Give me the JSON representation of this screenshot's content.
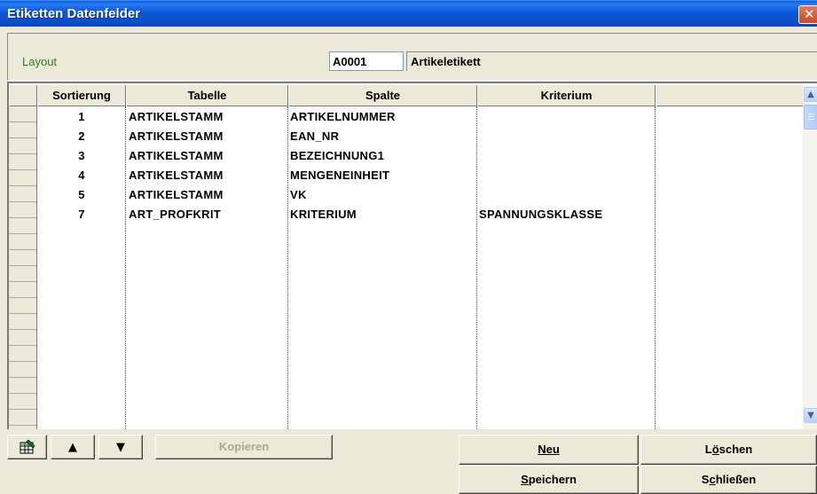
{
  "window": {
    "title": "Etiketten Datenfelder",
    "close_glyph": "✕"
  },
  "layout": {
    "label": "Layout",
    "code": "A0001",
    "name": "Artikeletikett"
  },
  "grid": {
    "columns": [
      "Sortierung",
      "Tabelle",
      "Spalte",
      "Kriterium",
      ""
    ],
    "rows": [
      {
        "sortierung": "1",
        "tabelle": "ARTIKELSTAMM",
        "spalte": "ARTIKELNUMMER",
        "kriterium": ""
      },
      {
        "sortierung": "2",
        "tabelle": "ARTIKELSTAMM",
        "spalte": "EAN_NR",
        "kriterium": ""
      },
      {
        "sortierung": "3",
        "tabelle": "ARTIKELSTAMM",
        "spalte": "BEZEICHNUNG1",
        "kriterium": ""
      },
      {
        "sortierung": "4",
        "tabelle": "ARTIKELSTAMM",
        "spalte": "MENGENEINHEIT",
        "kriterium": ""
      },
      {
        "sortierung": "5",
        "tabelle": "ARTIKELSTAMM",
        "spalte": "VK",
        "kriterium": ""
      },
      {
        "sortierung": "7",
        "tabelle": "ART_PROFKRIT",
        "spalte": "KRITERIUM",
        "kriterium": "SPANNUNGSKLASSE"
      }
    ]
  },
  "toolbar": {
    "grid_icon": "grid-edit-icon",
    "up_glyph": "▲",
    "down_glyph": "▼",
    "copy_label": "Kopieren",
    "new_label": "Neu",
    "delete_label_pre": "L",
    "delete_label_ul": "ö",
    "delete_label_post": "schen",
    "save_label_ul": "S",
    "save_label_post": "peichern",
    "close_label_pre": "S",
    "close_label_ul": "c",
    "close_label_post": "hließen"
  },
  "scroll": {
    "up_glyph": "▲",
    "down_glyph": "▼"
  },
  "colors": {
    "titlebar": "#0a4fcb",
    "layout_label": "#2d7a1c",
    "face": "#ece9d8"
  }
}
